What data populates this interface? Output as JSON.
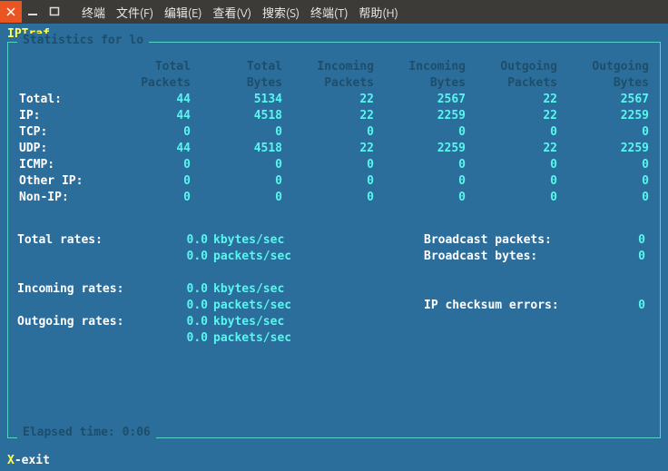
{
  "menu": {
    "terminal": "终端",
    "file": "文件(F)",
    "edit": "编辑(E)",
    "view": "查看(V)",
    "search": "搜索(S)",
    "terminal2": "终端(T)",
    "help": "帮助(H)"
  },
  "app_title": "IPTraf",
  "box_title": " Statistics for lo ",
  "headers": {
    "c1a": "Total",
    "c1b": "Packets",
    "c2a": "Total",
    "c2b": "Bytes",
    "c3a": "Incoming",
    "c3b": "Packets",
    "c4a": "Incoming",
    "c4b": "Bytes",
    "c5a": "Outgoing",
    "c5b": "Packets",
    "c6a": "Outgoing",
    "c6b": "Bytes"
  },
  "rows": {
    "total": {
      "label": "Total:",
      "p": "44",
      "b": "5134",
      "ip": "22",
      "ib": "2567",
      "op": "22",
      "ob": "2567"
    },
    "ip": {
      "label": "IP:",
      "p": "44",
      "b": "4518",
      "ip": "22",
      "ib": "2259",
      "op": "22",
      "ob": "2259"
    },
    "tcp": {
      "label": "TCP:",
      "p": "0",
      "b": "0",
      "ip": "0",
      "ib": "0",
      "op": "0",
      "ob": "0"
    },
    "udp": {
      "label": "UDP:",
      "p": "44",
      "b": "4518",
      "ip": "22",
      "ib": "2259",
      "op": "22",
      "ob": "2259"
    },
    "icmp": {
      "label": "ICMP:",
      "p": "0",
      "b": "0",
      "ip": "0",
      "ib": "0",
      "op": "0",
      "ob": "0"
    },
    "otherip": {
      "label": "Other IP:",
      "p": "0",
      "b": "0",
      "ip": "0",
      "ib": "0",
      "op": "0",
      "ob": "0"
    },
    "nonip": {
      "label": "Non-IP:",
      "p": "0",
      "b": "0",
      "ip": "0",
      "ib": "0",
      "op": "0",
      "ob": "0"
    }
  },
  "rates": {
    "total_label": "Total rates:",
    "total_kb": "0.0",
    "total_kb_unit": "kbytes/sec",
    "total_pk": "0.0",
    "total_pk_unit": "packets/sec",
    "in_label": "Incoming rates:",
    "in_kb": "0.0",
    "in_kb_unit": "kbytes/sec",
    "in_pk": "0.0",
    "in_pk_unit": "packets/sec",
    "out_label": "Outgoing rates:",
    "out_kb": "0.0",
    "out_kb_unit": "kbytes/sec",
    "out_pk": "0.0",
    "out_pk_unit": "packets/sec",
    "bc_pkts_label": "Broadcast packets:",
    "bc_pkts_val": "0",
    "bc_bytes_label": "Broadcast bytes:",
    "bc_bytes_val": "0",
    "cksum_label": "IP checksum errors:",
    "cksum_val": "0"
  },
  "elapsed_label": " Elapsed time: ",
  "elapsed_val": "  0:06 ",
  "exit_key": "X",
  "exit_label": "-exit"
}
